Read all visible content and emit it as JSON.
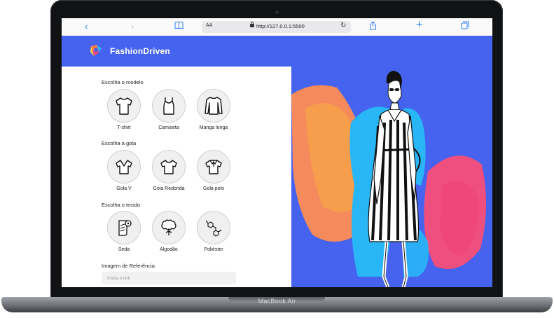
{
  "device": {
    "model": "MacBook Air"
  },
  "browser": {
    "aa_label": "AA",
    "url": "http://127.0.0.1:5500"
  },
  "site": {
    "brand": "FashionDriven"
  },
  "form": {
    "model_section": {
      "label": "Escolha o modelo",
      "options": [
        {
          "label": "T-shirt"
        },
        {
          "label": "Camiseta"
        },
        {
          "label": "Manga longa"
        }
      ]
    },
    "collar_section": {
      "label": "Escolha a gola",
      "options": [
        {
          "label": "Gola V"
        },
        {
          "label": "Gola Redonda"
        },
        {
          "label": "Gola polo"
        }
      ]
    },
    "fabric_section": {
      "label": "Escolha o tecido",
      "options": [
        {
          "label": "Seda"
        },
        {
          "label": "Algodão"
        },
        {
          "label": "Poliéster"
        }
      ]
    },
    "reference": {
      "label": "Imagem de Referência",
      "placeholder": "Insira o link"
    }
  },
  "colors": {
    "header": "#4563ee",
    "link_blue": "#2f7cf6"
  }
}
